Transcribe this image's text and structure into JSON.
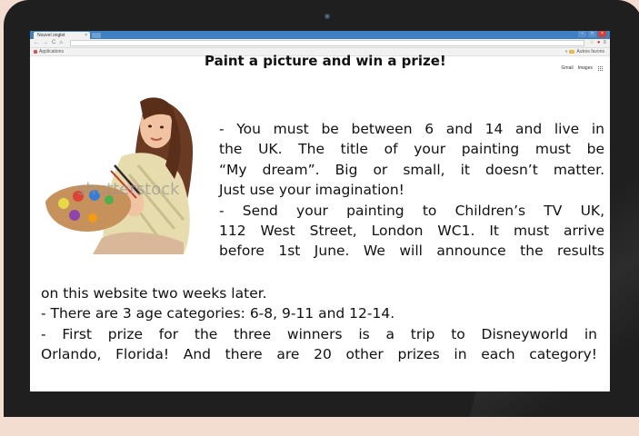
{
  "browser": {
    "tab_title": "Nouvel onglet",
    "tab_close": "×",
    "address": "",
    "bookmarks_left": "Applications",
    "bookmarks_right": "Autres favoris"
  },
  "google_links": {
    "gmail": "Gmail",
    "images": "Images"
  },
  "page": {
    "title": "Paint a picture and win a prize!",
    "watermark": "shutterstock",
    "lines_right": [
      "- You must be between 6 and 14 and live in",
      "the UK. The title of your painting must be",
      "“My dream”. Big or small, it doesn’t matter.",
      "Just use your imagination!",
      "- Send your painting to Children’s TV UK,",
      "112 West Street, London WC1. It must arrive",
      "before 1st June. We will announce the results"
    ],
    "lines_full": [
      "on this website two weeks later.",
      "- There are 3 age categories: 6-8, 9-11 and 12-14.",
      "- First prize for the three winners is a trip to Disneyworld in",
      "Orlando, Florida! And there are 20 other prizes in each category!"
    ]
  },
  "colors": {
    "background": "#f3dcd0",
    "bezel": "#1f1f1f",
    "tabbar": "#3f7fc3",
    "text": "#111111"
  }
}
